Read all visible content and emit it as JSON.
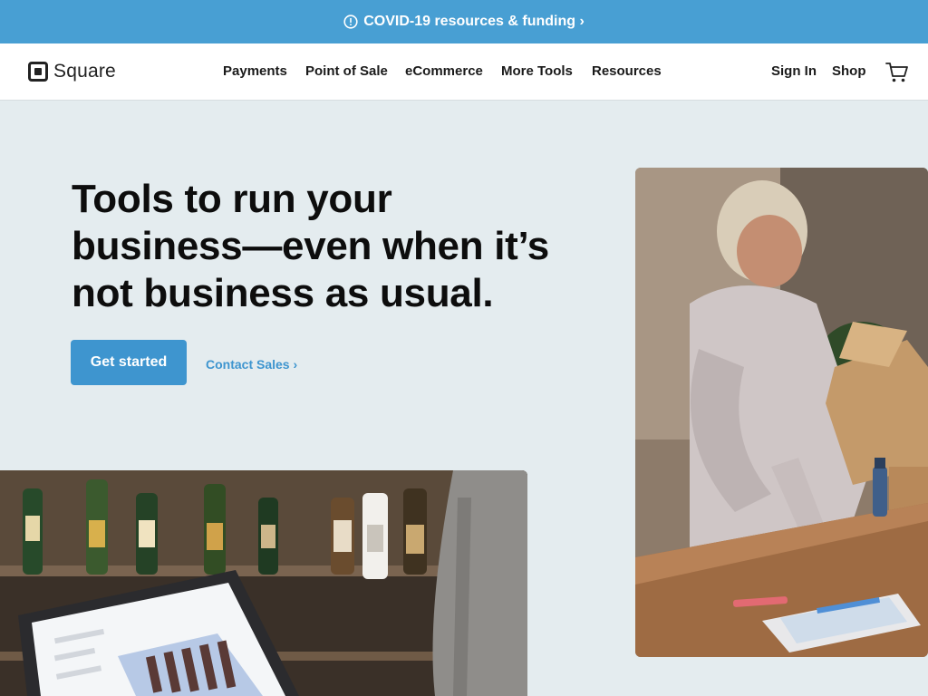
{
  "banner": {
    "text": "COVID-19 resources & funding ›",
    "icon": "info-circle-icon",
    "bg_color": "#489fd3"
  },
  "nav": {
    "logo_text": "Square",
    "items": [
      {
        "label": "Payments"
      },
      {
        "label": "Point of Sale"
      },
      {
        "label": "eCommerce"
      },
      {
        "label": "More Tools"
      },
      {
        "label": "Resources"
      }
    ],
    "sign_in": "Sign In",
    "shop": "Shop",
    "cart_icon": "cart-icon"
  },
  "hero": {
    "line1": "Tools to run your",
    "line2": "business—even when it’s",
    "line3": "not business as usual.",
    "cta_primary": "Get started",
    "cta_secondary": "Contact Sales ›"
  },
  "images": {
    "right": "woman-packing-box-with-tablet-photo",
    "left": "wine-shop-laptop-photo"
  },
  "colors": {
    "accent": "#3e95cf",
    "page_bg": "#e4ecef"
  }
}
